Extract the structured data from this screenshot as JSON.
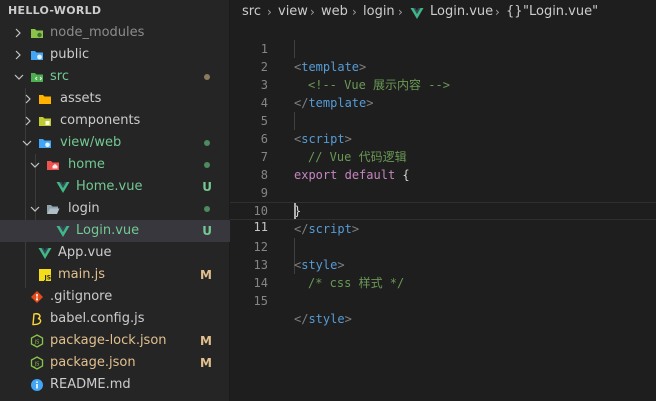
{
  "explorer": {
    "title": "HELLO-WORLD",
    "items": [
      {
        "label": "node_modules",
        "status": "",
        "dot": false
      },
      {
        "label": "public",
        "status": "",
        "dot": false
      },
      {
        "label": "src",
        "status": "",
        "dot": true
      },
      {
        "label": "assets",
        "status": "",
        "dot": false
      },
      {
        "label": "components",
        "status": "",
        "dot": false
      },
      {
        "label": "view/web",
        "status": "",
        "dot": true
      },
      {
        "label": "home",
        "status": "",
        "dot": true
      },
      {
        "label": "Home.vue",
        "status": "U",
        "dot": false
      },
      {
        "label": "login",
        "status": "",
        "dot": true
      },
      {
        "label": "Login.vue",
        "status": "U",
        "dot": false
      },
      {
        "label": "App.vue",
        "status": "",
        "dot": false
      },
      {
        "label": "main.js",
        "status": "M",
        "dot": false
      },
      {
        "label": ".gitignore",
        "status": "",
        "dot": false
      },
      {
        "label": "babel.config.js",
        "status": "",
        "dot": false
      },
      {
        "label": "package-lock.json",
        "status": "M",
        "dot": false
      },
      {
        "label": "package.json",
        "status": "M",
        "dot": false
      },
      {
        "label": "README.md",
        "status": "",
        "dot": false
      }
    ]
  },
  "breadcrumb": {
    "parts": [
      "src",
      "view",
      "web",
      "login",
      "Login.vue"
    ],
    "symbol_icon": "{}",
    "symbol": "\"Login.vue\""
  },
  "editor": {
    "lines": [
      {
        "n": "1"
      },
      {
        "n": "2"
      },
      {
        "n": "3"
      },
      {
        "n": "4"
      },
      {
        "n": "5"
      },
      {
        "n": "6"
      },
      {
        "n": "7"
      },
      {
        "n": "8"
      },
      {
        "n": "9"
      },
      {
        "n": "10"
      },
      {
        "n": "11"
      },
      {
        "n": "12"
      },
      {
        "n": "13"
      },
      {
        "n": "14"
      },
      {
        "n": "15"
      }
    ],
    "tokens": {
      "lt": "<",
      "gt": ">",
      "lt_slash": "</",
      "template": "template",
      "script": "script",
      "style": "style",
      "comment_html": "<!-- Vue 展示内容 -->",
      "comment_js": "// Vue 代码逻辑",
      "export": "export",
      "default": "default",
      "open_brace": "{",
      "close_brace": "}",
      "comment_css": "/* css 样式 */"
    }
  },
  "colors": {
    "untracked": "#73c991",
    "modified": "#e2c08d",
    "folder_text_modified": "#73c991",
    "sidebar_bg": "#252526",
    "editor_bg": "#1e1e1e"
  }
}
